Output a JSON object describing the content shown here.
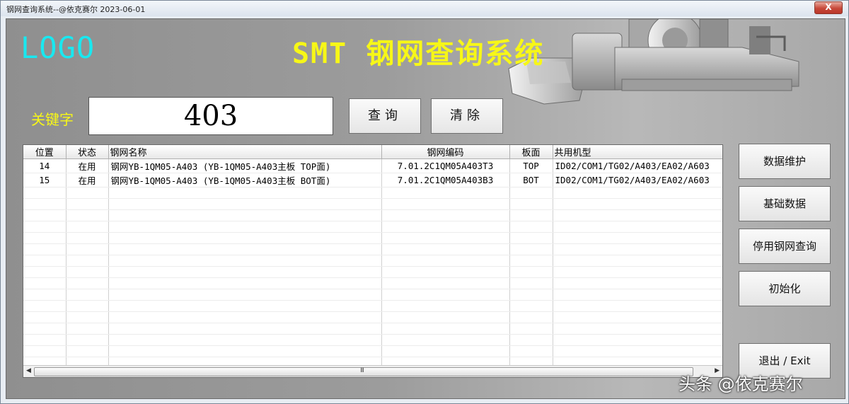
{
  "window": {
    "title": "钢网查询系统--@依克赛尔 2023-06-01",
    "close_label": "X"
  },
  "header": {
    "logo": "LOGO",
    "title": "SMT 钢网查询系统"
  },
  "search": {
    "label": "关键字",
    "value": "403",
    "query_button": "查询",
    "clear_button": "清除"
  },
  "grid": {
    "columns": [
      "位置",
      "状态",
      "钢网名称",
      "钢网编码",
      "板面",
      "共用机型"
    ],
    "rows": [
      [
        "14",
        "在用",
        "钢网YB-1QM05-A403 (YB-1QM05-A403主板 TOP面)",
        "7.01.2C1QM05A403T3",
        "TOP",
        "ID02/COM1/TG02/A403/EA02/A603"
      ],
      [
        "15",
        "在用",
        "钢网YB-1QM05-A403 (YB-1QM05-A403主板 BOT面)",
        "7.01.2C1QM05A403B3",
        "BOT",
        "ID02/COM1/TG02/A403/EA02/A603"
      ]
    ],
    "empty_rows": 18,
    "scroll_grip": "III"
  },
  "side_buttons": {
    "data_maintenance": "数据维护",
    "base_data": "基础数据",
    "disabled_stencil_query": "停用钢网查询",
    "initialize": "初始化",
    "exit": "退出 / Exit"
  },
  "watermark": "头条 @依克赛尔",
  "colors": {
    "logo": "#19e8f0",
    "title": "#f7f717",
    "label": "#f7f717"
  }
}
